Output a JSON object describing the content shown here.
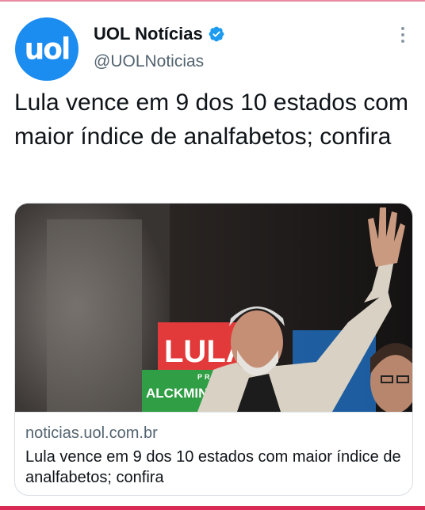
{
  "account": {
    "display_name": "UOL Notícias",
    "handle": "@UOLNoticias",
    "avatar_text": "uol"
  },
  "tweet": {
    "text": "Lula vence em 9 dos 10 estados com maior índice de analfabetos; confira"
  },
  "card": {
    "domain": "noticias.uol.com.br",
    "title": "Lula vence em 9 dos 10 estados com maior índice de analfabetos; confira",
    "image_banner_main": "LULA",
    "image_banner_sub": "PRESIDENTE",
    "image_banner_second": "ALCKMIN"
  },
  "colors": {
    "avatar_bg": "#1b8cf0",
    "verified": "#1d9bf0",
    "banner_red": "#e23a3a",
    "banner_green": "#2f9e44"
  },
  "icons": {
    "verified": "verified-badge-icon",
    "more": "more-options-icon"
  }
}
